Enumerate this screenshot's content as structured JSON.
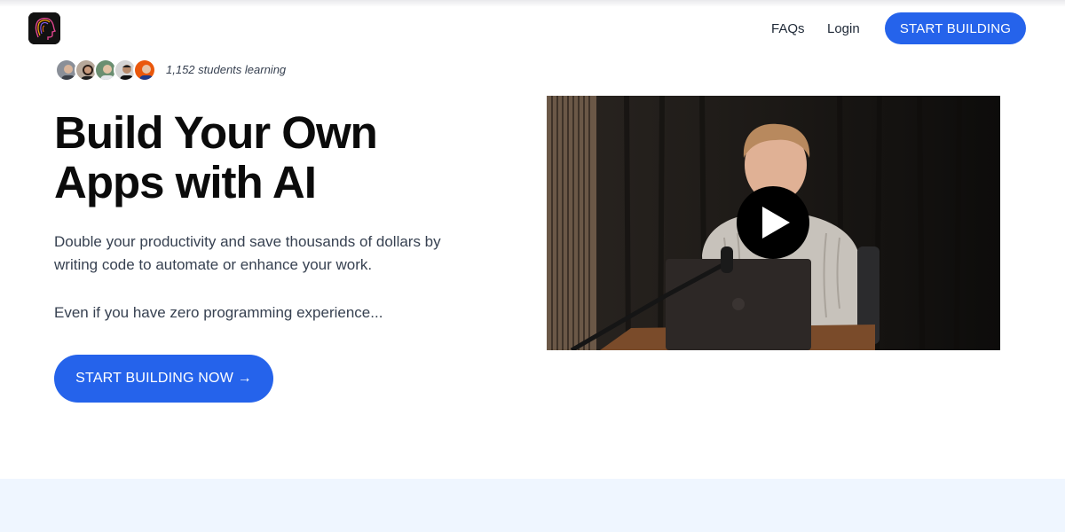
{
  "header": {
    "logo_icon": "brain-head-icon",
    "nav": [
      {
        "label": "FAQs"
      },
      {
        "label": "Login"
      }
    ],
    "cta_label": "START BUILDING"
  },
  "social_proof": {
    "avatar_count": 5,
    "students_text": "1,152 students learning"
  },
  "hero": {
    "headline": "Build Your Own Apps with AI",
    "subtitle": "Double your productivity and save thousands of dollars by writing code to automate or enhance your work.",
    "subtitle2": "Even if you have zero programming experience...",
    "cta_label": "START BUILDING NOW →"
  },
  "video": {
    "play_icon": "play-icon"
  },
  "colors": {
    "accent": "#2563eb",
    "band": "#eff6ff",
    "text": "#111827"
  }
}
